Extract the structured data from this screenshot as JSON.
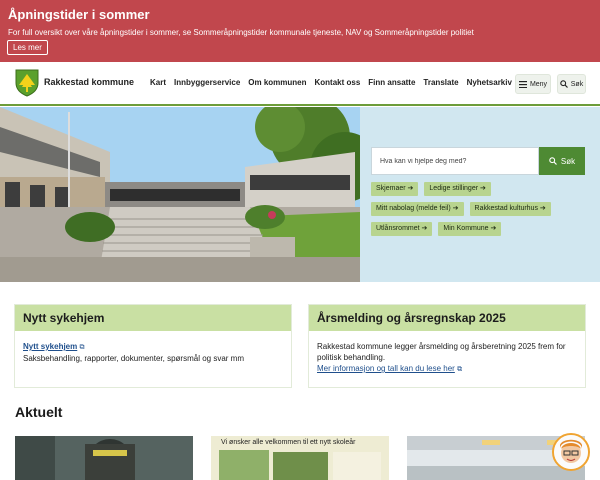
{
  "alert": {
    "title": "Åpningstider i sommer",
    "text": "For full oversikt over våre åpningstider i sommer, se Sommeråpningstider kommunale tjeneste, NAV og  Sommeråpningstider politiet",
    "button": "Les mer"
  },
  "header": {
    "brand": "Rakkestad kommune",
    "nav": [
      "Kart",
      "Innbyggerservice",
      "Om kommunen",
      "Kontakt oss",
      "Finn ansatte",
      "Translate",
      "Nyhetsarkiv"
    ],
    "menu_label": "Meny",
    "search_label": "Søk"
  },
  "hero": {
    "search_placeholder": "Hva kan vi hjelpe deg med?",
    "search_button": "Søk",
    "quick_links": [
      "Skjemaer",
      "Ledige stillinger",
      "Mitt nabolag (melde feil)",
      "Rakkestad kulturhus",
      "Utlånsrommet",
      "Min Kommune"
    ]
  },
  "cards": {
    "card1": {
      "title": "Nytt sykehjem",
      "link": "Nytt sykehjem",
      "text": "Saksbehandling, rapporter, dokumenter, spørsmål og svar mm"
    },
    "card2": {
      "title": "Årsmelding og årsregnskap 2025",
      "text": "Rakkestad kommune legger årsmelding og årsberetning 2025 frem for politisk behandling.",
      "link": "Mer informasjon og tall kan du lese her"
    }
  },
  "news": {
    "title": "Aktuelt",
    "item2_caption": "Vi ønsker alle velkommen til ett nytt skoleår"
  },
  "colors": {
    "alert_bg": "#c1474d",
    "accent_green": "#4e8a33",
    "chip_green": "#b8d48f",
    "card_header": "#c9e0a3",
    "hero_panel": "#d1e7f0"
  }
}
